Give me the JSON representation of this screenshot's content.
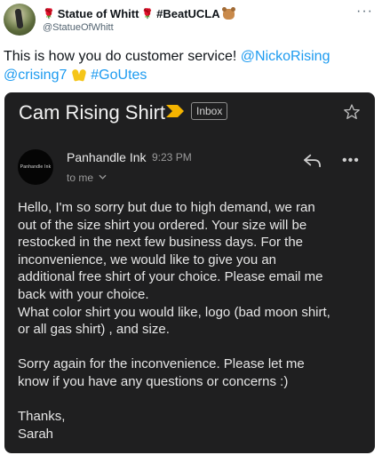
{
  "tweet": {
    "display_name_parts": [
      "Statue of Whitt",
      "#BeatUCLA"
    ],
    "handle": "@StatueOfWhitt",
    "text_prefix": "This is how you do customer service! ",
    "mention1": "@NickoRising",
    "mention2": "@crising7",
    "hashtag": "#GoUtes",
    "emoji_rose": "🌹",
    "more_label": "···"
  },
  "email": {
    "subject": "Cam Rising Shirt",
    "label": "Inbox",
    "sender_name": "Panhandle Ink",
    "sender_logo_text": "Panhandle Ink",
    "time": "9:23 PM",
    "recipient": "to me",
    "more_label": "•••",
    "body_lines": [
      "Hello, I'm so sorry but due to high demand, we ran",
      "out of the size shirt you ordered.  Your size will be",
      "restocked in the next few business days.  For the",
      "inconvenience, we would like to give you an",
      "additional free shirt of your choice.  Please email me",
      "back with your choice.",
      "What color shirt you would like, logo (bad moon shirt,",
      "or all gas shirt) , and size.",
      "",
      "Sorry again for the inconvenience.  Please let me",
      "know if you have any questions or concerns :)",
      "",
      "Thanks,",
      "Sarah"
    ]
  },
  "colors": {
    "link": "#1d9bf0",
    "email_background": "#1f1f20",
    "important_marker": "#f4b400"
  },
  "icons": [
    "avatar-photo",
    "rose-icon",
    "bear-icon",
    "raised-hands-icon",
    "important-marker-icon",
    "star-icon",
    "reply-icon",
    "more-icon",
    "chevron-down-icon"
  ]
}
